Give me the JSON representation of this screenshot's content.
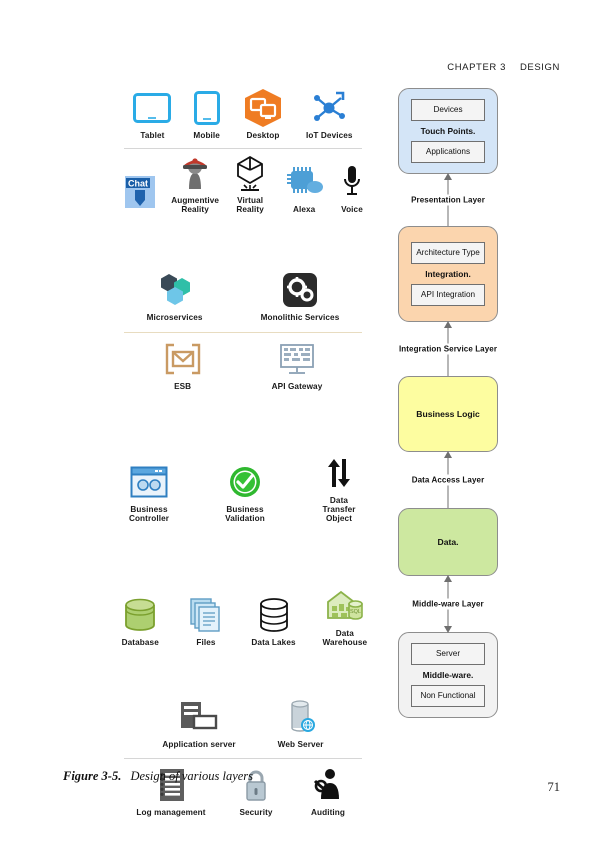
{
  "header": {
    "chapter": "CHAPTER 3",
    "title": "DESIGN"
  },
  "figure": {
    "number": "Figure 3-5.",
    "caption": "Design of various layers"
  },
  "folio": "71",
  "icon_groups": [
    {
      "name": "presentation-icons",
      "rows": [
        {
          "items": [
            {
              "label": "Tablet",
              "icon": "tablet-icon"
            },
            {
              "label": "Mobile",
              "icon": "mobile-icon"
            },
            {
              "label": "Desktop",
              "icon": "desktop-icon"
            },
            {
              "label": "IoT Devices",
              "icon": "iot-devices-icon"
            }
          ]
        },
        {
          "items": [
            {
              "label": "",
              "icon": "chat-icon"
            },
            {
              "label": "Augmentive Reality",
              "icon": "augmented-reality-icon"
            },
            {
              "label": "Virtual Reality",
              "icon": "virtual-reality-icon"
            },
            {
              "label": "Alexa",
              "icon": "alexa-icon"
            },
            {
              "label": "Voice",
              "icon": "voice-icon"
            }
          ]
        }
      ]
    },
    {
      "name": "integration-icons",
      "rows": [
        {
          "items": [
            {
              "label": "Microservices",
              "icon": "microservices-icon"
            },
            {
              "label": "Monolithic Services",
              "icon": "monolithic-services-icon"
            }
          ]
        },
        {
          "items": [
            {
              "label": "ESB",
              "icon": "esb-icon"
            },
            {
              "label": "API Gateway",
              "icon": "api-gateway-icon"
            }
          ]
        }
      ]
    },
    {
      "name": "business-logic-icons",
      "rows": [
        {
          "items": [
            {
              "label": "Business Controller",
              "icon": "business-controller-icon"
            },
            {
              "label": "Business Validation",
              "icon": "business-validation-icon"
            },
            {
              "label": "Data Transfer Object",
              "icon": "data-transfer-object-icon"
            }
          ]
        }
      ]
    },
    {
      "name": "data-icons",
      "rows": [
        {
          "items": [
            {
              "label": "Database",
              "icon": "database-icon"
            },
            {
              "label": "Files",
              "icon": "files-icon"
            },
            {
              "label": "Data Lakes",
              "icon": "data-lakes-icon"
            },
            {
              "label": "Data Warehouse",
              "icon": "data-warehouse-icon"
            }
          ]
        }
      ]
    },
    {
      "name": "middleware-icons",
      "rows": [
        {
          "items": [
            {
              "label": "Application server",
              "icon": "application-server-icon"
            },
            {
              "label": "Web Server",
              "icon": "web-server-icon"
            }
          ]
        },
        {
          "items": [
            {
              "label": "Log management",
              "icon": "log-management-icon"
            },
            {
              "label": "Security",
              "icon": "security-lock-icon"
            },
            {
              "label": "Auditing",
              "icon": "auditing-icon"
            }
          ]
        }
      ]
    }
  ],
  "layers": [
    {
      "name": "presentation",
      "top_box": "Devices",
      "middle_label": "Touch Points.",
      "bottom_box": "Applications",
      "fill": "#d4e5f7",
      "connector_label": "Presentation Layer"
    },
    {
      "name": "integration",
      "top_box": "Architecture Type",
      "middle_label": "Integration.",
      "bottom_box": "API Integration",
      "fill": "#fbd5ae",
      "connector_label": "Integration Service  Layer"
    },
    {
      "name": "business-logic",
      "solo_label": "Business Logic",
      "fill": "#fdfda0",
      "connector_label": "Data Access Layer"
    },
    {
      "name": "data",
      "solo_label": "Data.",
      "fill": "#cde8a0",
      "connector_label": "Middle-ware Layer"
    },
    {
      "name": "middleware",
      "top_box": "Server",
      "middle_label": "Middle-ware.",
      "bottom_box": "Non Functional",
      "fill": "#f2f2f2",
      "connector_label": ""
    }
  ]
}
